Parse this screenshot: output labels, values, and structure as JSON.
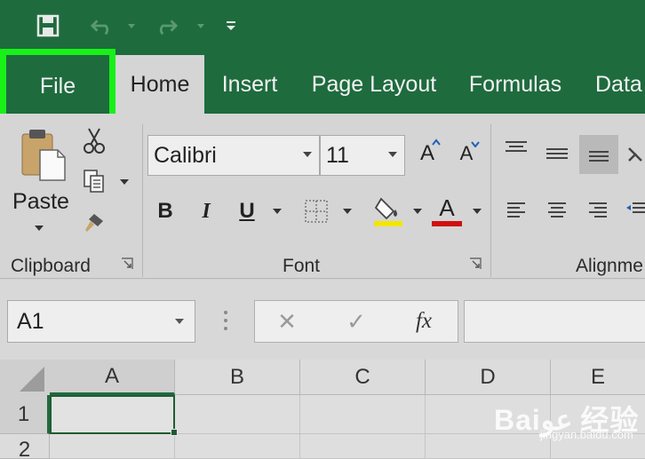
{
  "quick_access": {
    "save_icon": "save-icon",
    "undo_icon": "undo-icon",
    "redo_icon": "redo-icon",
    "customize_icon": "customize-quick-access-icon"
  },
  "tabs": [
    "File",
    "Home",
    "Insert",
    "Page Layout",
    "Formulas",
    "Data"
  ],
  "clipboard": {
    "paste_label": "Paste",
    "group_label": "Clipboard"
  },
  "font": {
    "family": "Calibri",
    "size": "11",
    "increase_label": "A",
    "decrease_label": "A",
    "bold_label": "B",
    "italic_label": "I",
    "underline_label": "U",
    "font_color_label": "A",
    "group_label": "Font",
    "fill_color": "#f2e600",
    "font_color": "#d01010"
  },
  "alignment": {
    "group_label": "Alignme"
  },
  "formula_bar": {
    "name_box": "A1",
    "cancel_label": "✕",
    "enter_label": "✓",
    "fx_label": "fx",
    "value": ""
  },
  "sheet": {
    "columns": [
      "A",
      "B",
      "C",
      "D",
      "E"
    ],
    "rows": [
      "1",
      "2"
    ],
    "active_cell": "A1"
  },
  "watermark": {
    "logo": "Baiعو 经验",
    "url": "jingyan.baidu.com"
  },
  "colors": {
    "ribbon_green": "#1e6b3e",
    "file_highlight": "#18f018"
  }
}
